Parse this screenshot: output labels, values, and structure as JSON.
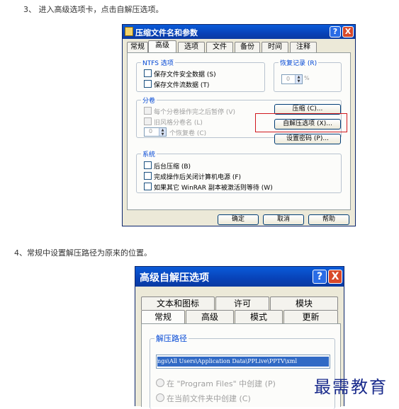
{
  "step3": "3、 进入高级选项卡，点击自解压选项。",
  "step4": "4、常规中设置解压路径为原来的位置。",
  "dialog1": {
    "title": "压缩文件名和参数",
    "help": "?",
    "close": "X",
    "tabs": [
      "常规",
      "高级",
      "选项",
      "文件",
      "备份",
      "时间",
      "注释"
    ],
    "ntfs_group": "NTFS 选项",
    "ntfs_opts": [
      "保存文件安全数据 (S)",
      "保存文件流数据 (T)"
    ],
    "recovery_group": "恢复记录 (R)",
    "recovery_value": "0",
    "recovery_unit": "%",
    "volume_group": "分卷",
    "volume_opts": [
      "每个分卷操作完之后暂停 (V)",
      "旧风格分卷名 (L)"
    ],
    "recovery_volumes_value": "0",
    "recovery_volumes_label": "个恢复卷 (C)",
    "btn_compress": "压缩 (C)...",
    "btn_sfx": "自解压选项 (X)...",
    "btn_password": "设置密码 (P)...",
    "system_group": "系统",
    "system_opts": [
      "后台压缩 (B)",
      "完成操作后关闭计算机电源 (F)",
      "如果其它 WinRAR 副本被激活则等待 (W)"
    ],
    "ok": "确定",
    "cancel": "取消",
    "helpbtn": "帮助"
  },
  "dialog2": {
    "title": "高级自解压选项",
    "help": "?",
    "close": "X",
    "tabs_row1": [
      "文本和图标",
      "许可",
      "模块"
    ],
    "tabs_row2": [
      "常规",
      "高级",
      "模式",
      "更新"
    ],
    "path_group": "解压路径",
    "path_value": "ngs\\All Users\\Application Data\\PPLive\\PPTV\\xml",
    "radio1": "在 \"Program Files\" 中创建 (P)",
    "radio2": "在当前文件夹中创建 (C)"
  },
  "watermark": "最需教育"
}
